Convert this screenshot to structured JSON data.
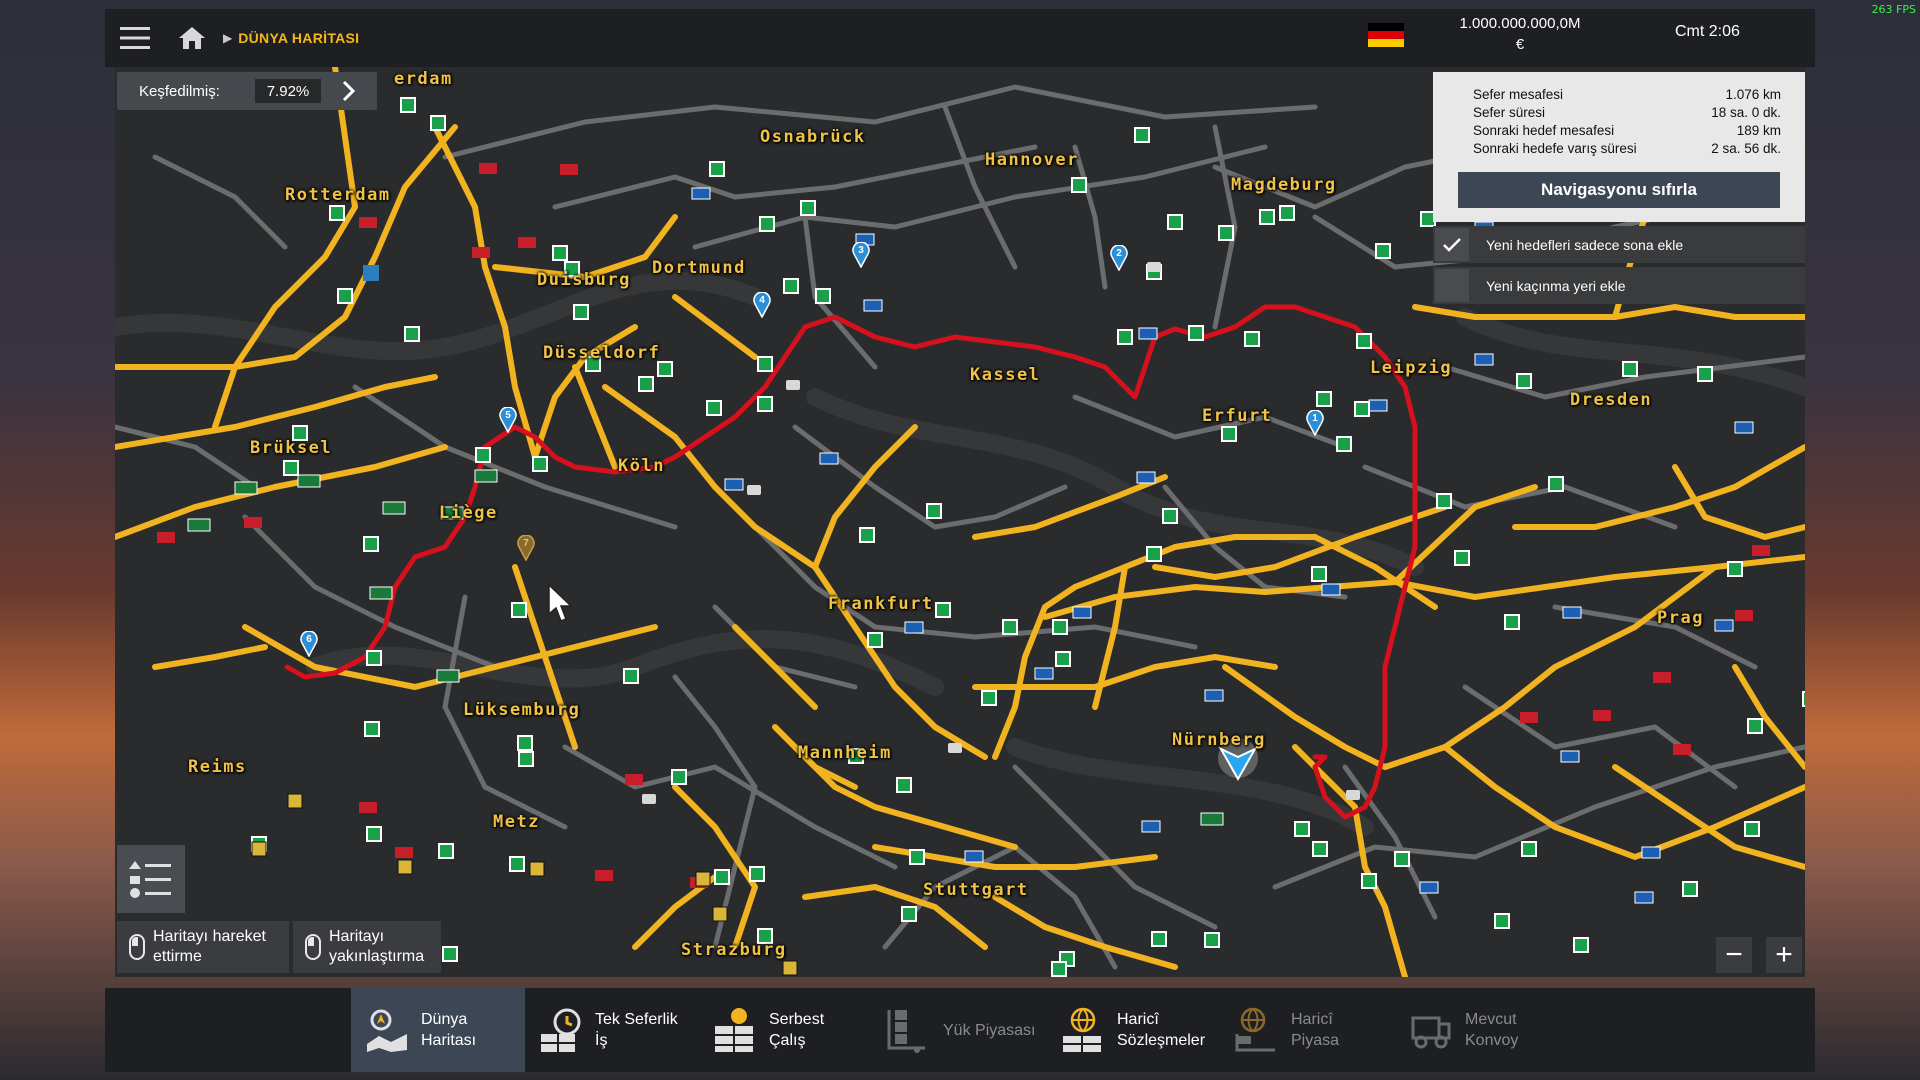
{
  "fps": "263 FPS",
  "header": {
    "breadcrumb": "DÜNYA HARİTASI",
    "money_line1": "1.000.000.000,0M",
    "money_line2": "€",
    "clock": "Cmt 2:06",
    "flag_colors": [
      "#000000",
      "#dd0000",
      "#ffcc00"
    ]
  },
  "explored": {
    "label": "Keşfedilmiş:",
    "value": "7.92%"
  },
  "navigation": {
    "rows": [
      {
        "label": "Sefer mesafesi",
        "value": "1.076 km"
      },
      {
        "label": "Sefer süresi",
        "value": "18 sa. 0 dk."
      },
      {
        "label": "Sonraki hedef mesafesi",
        "value": "189 km"
      },
      {
        "label": "Sonraki hedefe varış süresi",
        "value": "2 sa. 56 dk."
      }
    ],
    "reset_button": "Navigasyonu sıfırla",
    "option1": "Yeni hedefleri sadece sona ekle",
    "option1_checked": true,
    "option2": "Yeni kaçınma yeri ekle",
    "option2_checked": false
  },
  "cities": {
    "amsterdam": "erdam",
    "osnabruck": "Osnabrück",
    "hannover": "Hannover",
    "rotterdam": "Rotterdam",
    "magdeburg": "Magdeburg",
    "duisburg": "Duisburg",
    "dortmund": "Dortmund",
    "dusseldorf": "Düsseldorf",
    "kassel": "Kassel",
    "leipzig": "Leipzig",
    "dresden": "Dresden",
    "brussel": "Brüksel",
    "erfurt": "Erfurt",
    "koln": "Köln",
    "liege": "Liège",
    "frankfurt": "Frankfurt",
    "prag": "Prag",
    "luksemburg": "Lüksemburg",
    "nurnberg": "Nürnberg",
    "reims": "Reims",
    "mannheim": "Mannheim",
    "metz": "Metz",
    "stuttgart": "Stuttgart",
    "strazburg": "Strazburg"
  },
  "waypoints": [
    "1",
    "2",
    "3",
    "4",
    "5",
    "6",
    "7"
  ],
  "colors": {
    "route": "#d4111c",
    "highway": "#f2b320",
    "road": "#6b6c6e",
    "waypoint": "#2c8fd6",
    "service": "#18a04a"
  },
  "hints": {
    "move_map": "Haritayı hareket ettirme",
    "move_map_l1": "Haritayı hareket",
    "move_map_l2": "ettirme",
    "zoom_map_l1": "Haritayı",
    "zoom_map_l2": "yakınlaştırma"
  },
  "zoom": {
    "minus": "−",
    "plus": "+"
  },
  "tabs": [
    {
      "l1": "Dünya",
      "l2": "Haritası",
      "icon": "world-map-icon"
    },
    {
      "l1": "Tek Seferlik",
      "l2": "İş",
      "icon": "single-job-icon"
    },
    {
      "l1": "Serbest",
      "l2": "Çalış",
      "icon": "freight-market-icon"
    },
    {
      "l1": "Yük Piyasası",
      "l2": "",
      "icon": "cargo-market-icon"
    },
    {
      "l1": "Haricî",
      "l2": "Sözleşmeler",
      "icon": "external-contracts-icon"
    },
    {
      "l1": "Haricî",
      "l2": "Piyasa",
      "icon": "external-market-icon"
    },
    {
      "l1": "Mevcut",
      "l2": "Konvoy",
      "icon": "convoy-icon"
    }
  ]
}
